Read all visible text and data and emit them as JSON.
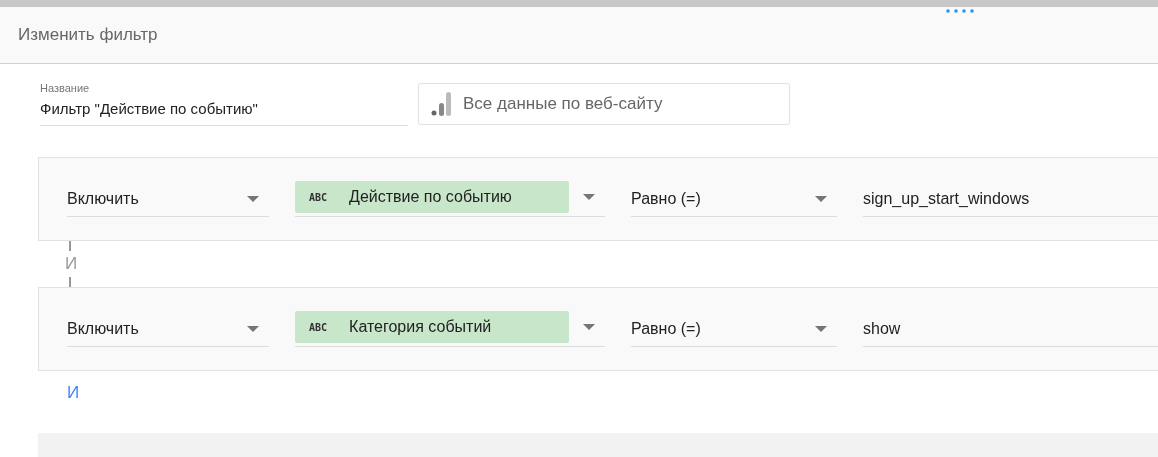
{
  "dialog": {
    "title": "Изменить фильтр"
  },
  "name_field": {
    "label": "Название",
    "value": "Фильтр \"Действие по событию\""
  },
  "segment": {
    "label": "Все данные по веб-сайту"
  },
  "conditions": [
    {
      "mode": "Включить",
      "dimension": {
        "type_label": "ABC",
        "name": "Действие по событию"
      },
      "operator": "Равно (=)",
      "value": "sign_up_start_windows"
    },
    {
      "mode": "Включить",
      "dimension": {
        "type_label": "ABC",
        "name": "Категория событий"
      },
      "operator": "Равно (=)",
      "value": "show"
    }
  ],
  "connector": "И",
  "add_and": "И"
}
